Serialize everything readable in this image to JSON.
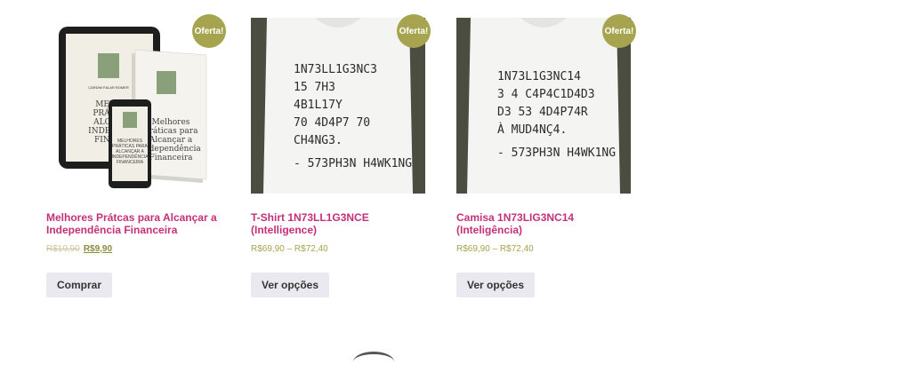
{
  "products": [
    {
      "badge": "Oferta!",
      "title": "Melhores Prátcas para Alcançar a Independência Financeira",
      "price_old": "R$19,90",
      "price_new": "R$9,90",
      "button": "Comprar",
      "image_type": "ebook-mockup",
      "cover_author": "CARDIM FALAR ROMER",
      "cover_title": "MELHORES PRÁTICAS PARA ALCANÇAR A INDEPENDÊNCIA FINANCEIRA"
    },
    {
      "badge": "Oferta!",
      "title": "T-Shirt 1N73LL1G3NCE (Intelligence)",
      "price_range": "R$69,90 – R$72,40",
      "button": "Ver opções",
      "image_type": "tshirt",
      "shirt_lines": [
        "1N73LL1G3NC3",
        "15 7H3",
        "4B1L17Y",
        "70 4D4P7 70",
        "CH4NG3."
      ],
      "shirt_sign": "- 573PH3N H4WK1NG"
    },
    {
      "badge": "Oferta!",
      "title": "Camisa 1N73LIG3NC14 (Inteligência)",
      "price_range": "R$69,90 – R$72,40",
      "button": "Ver opções",
      "image_type": "tshirt",
      "shirt_lines": [
        "1N73L1G3NC14",
        "3 4 C4P4C1D4D3",
        "D3 53 4D4P74R",
        "À MUD4NÇ4."
      ],
      "shirt_sign": "- 573PH3N H4WK1NG"
    }
  ],
  "colors": {
    "accent": "#c5307a",
    "badge": "#a6a44f",
    "button_bg": "#ebe9f0"
  }
}
